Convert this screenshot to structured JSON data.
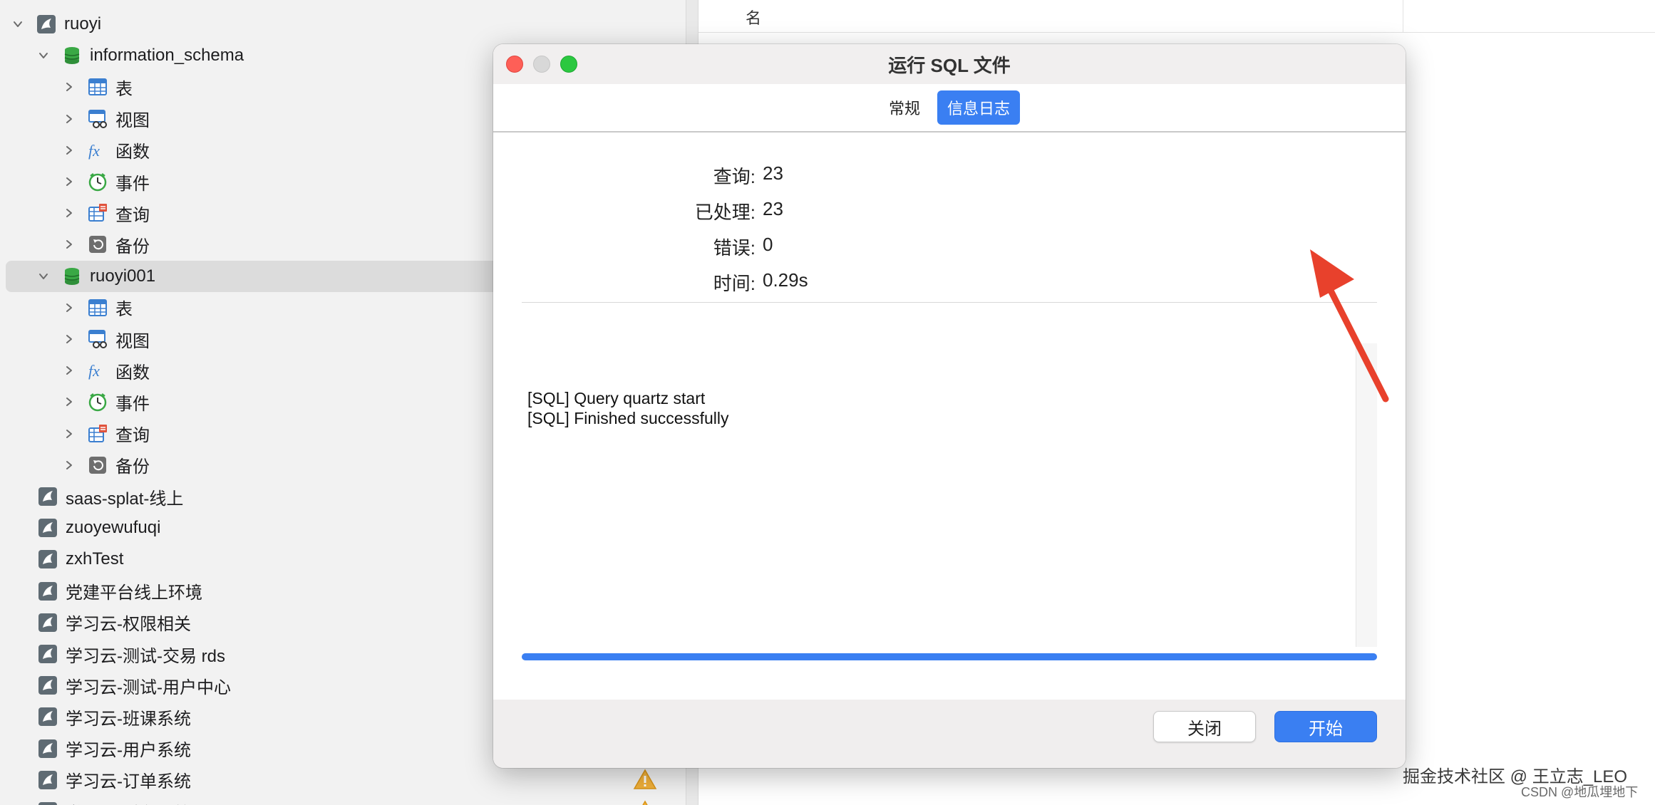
{
  "sidebar": {
    "rows": [
      {
        "label": "ruoyi",
        "icon": "dolphin-connection-icon",
        "expanded": true
      },
      {
        "label": "information_schema",
        "icon": "database-icon",
        "expanded": true
      },
      {
        "label": "表",
        "icon": "table-icon"
      },
      {
        "label": "视图",
        "icon": "view-icon"
      },
      {
        "label": "函数",
        "icon": "function-icon"
      },
      {
        "label": "事件",
        "icon": "event-clock-icon"
      },
      {
        "label": "查询",
        "icon": "query-icon"
      },
      {
        "label": "备份",
        "icon": "backup-icon"
      },
      {
        "label": "ruoyi001",
        "icon": "database-icon",
        "expanded": true,
        "selected": true
      },
      {
        "label": "表",
        "icon": "table-icon"
      },
      {
        "label": "视图",
        "icon": "view-icon"
      },
      {
        "label": "函数",
        "icon": "function-icon"
      },
      {
        "label": "事件",
        "icon": "event-clock-icon"
      },
      {
        "label": "查询",
        "icon": "query-icon"
      },
      {
        "label": "备份",
        "icon": "backup-icon"
      },
      {
        "label": "saas-splat-线上",
        "icon": "dolphin-connection-icon"
      },
      {
        "label": "zuoyewufuqi",
        "icon": "dolphin-connection-icon"
      },
      {
        "label": "zxhTest",
        "icon": "dolphin-connection-icon"
      },
      {
        "label": "党建平台线上环境",
        "icon": "dolphin-connection-icon"
      },
      {
        "label": "学习云-权限相关",
        "icon": "dolphin-connection-icon"
      },
      {
        "label": "学习云-测试-交易 rds",
        "icon": "dolphin-connection-icon"
      },
      {
        "label": "学习云-测试-用户中心",
        "icon": "dolphin-connection-icon"
      },
      {
        "label": "学习云-班课系统",
        "icon": "dolphin-connection-icon"
      },
      {
        "label": "学习云-用户系统",
        "icon": "dolphin-connection-icon"
      },
      {
        "label": "学习云-订单系统",
        "icon": "dolphin-connection-icon",
        "warning": true
      },
      {
        "label": "学习云-财务系统",
        "icon": "dolphin-connection-icon",
        "warning": true
      }
    ]
  },
  "right_pane": {
    "column_header": "名"
  },
  "dialog": {
    "title": "运行 SQL 文件",
    "tabs": [
      {
        "label": "常规",
        "active": false
      },
      {
        "label": "信息日志",
        "active": true
      }
    ],
    "stats": [
      {
        "label": "查询:",
        "value": "23"
      },
      {
        "label": "已处理:",
        "value": "23"
      },
      {
        "label": "错误:",
        "value": "0"
      },
      {
        "label": "时间:",
        "value": "0.29s"
      }
    ],
    "log_lines": [
      "[SQL] Query quartz start",
      "[SQL] Finished successfully"
    ],
    "progress_fraction": 1.0,
    "buttons": {
      "close": "关闭",
      "start": "开始"
    }
  },
  "watermark": {
    "line1": "掘金技术社区 @ 王立志_LEO",
    "line2": "CSDN @地瓜埋地下"
  },
  "colors": {
    "accent": "#3a7ff2",
    "arrow": "#e8412c",
    "database_green": "#3aa845"
  }
}
